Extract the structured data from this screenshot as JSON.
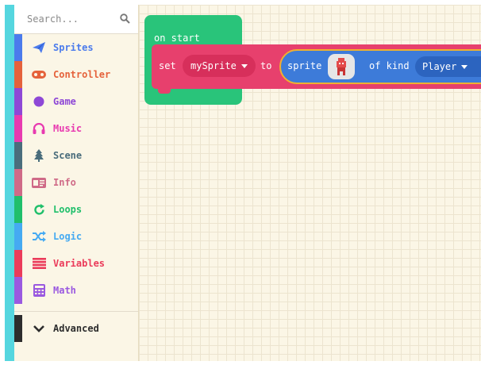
{
  "toolbox": {
    "search_placeholder": "Search...",
    "categories": [
      {
        "label": "Sprites",
        "color": "#4b7bec",
        "icon": "paper-plane-icon"
      },
      {
        "label": "Controller",
        "color": "#e5623b",
        "icon": "gamepad-icon"
      },
      {
        "label": "Game",
        "color": "#8e48d6",
        "icon": "circle-icon"
      },
      {
        "label": "Music",
        "color": "#e83ab0",
        "icon": "headphones-icon"
      },
      {
        "label": "Scene",
        "color": "#4a6d7c",
        "icon": "tree-icon"
      },
      {
        "label": "Info",
        "color": "#cf6a87",
        "icon": "id-card-icon"
      },
      {
        "label": "Loops",
        "color": "#20bf6b",
        "icon": "refresh-icon"
      },
      {
        "label": "Logic",
        "color": "#45aaf2",
        "icon": "shuffle-icon"
      },
      {
        "label": "Variables",
        "color": "#eb3b5a",
        "icon": "list-icon"
      },
      {
        "label": "Math",
        "color": "#9a59e0",
        "icon": "calculator-icon"
      },
      {
        "label": "Advanced",
        "color": "#2d2d2d",
        "icon": "chevron-down-icon"
      }
    ]
  },
  "workspace": {
    "on_start_label": "on start",
    "set_label": "set",
    "variable_name": "mySprite",
    "to_label": "to",
    "sprite_label": "sprite",
    "of_kind_label": "of kind",
    "kind_value": "Player"
  }
}
